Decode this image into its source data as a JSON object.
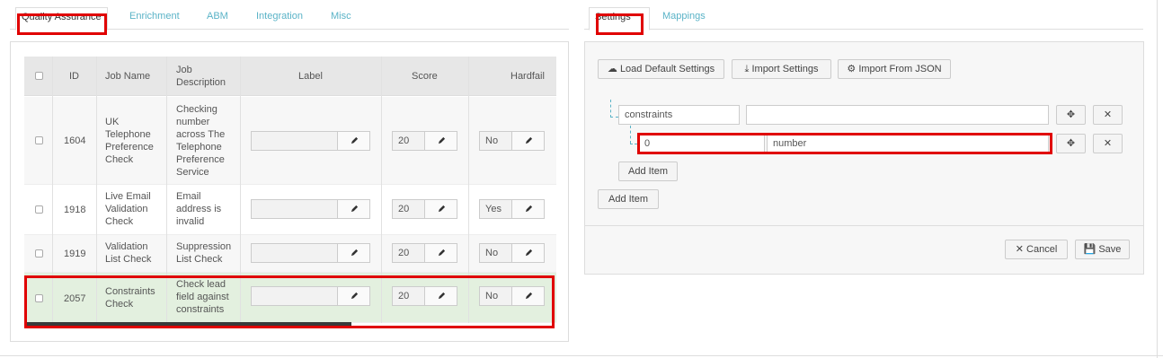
{
  "left_tabs": [
    "Quality Assurance",
    "Enrichment",
    "ABM",
    "Integration",
    "Misc"
  ],
  "right_tabs": [
    "Settings",
    "Mappings"
  ],
  "table": {
    "headers": [
      "ID",
      "Job Name",
      "Job Description",
      "Label",
      "Score",
      "Hardfail"
    ],
    "rows": [
      {
        "id": "1604",
        "name": "UK Telephone Preference Check",
        "desc": "Checking number across The Telephone Preference Service",
        "label": "",
        "score": "20",
        "hardfail": "No"
      },
      {
        "id": "1918",
        "name": "Live Email Validation Check",
        "desc": "Email address is invalid",
        "label": "",
        "score": "20",
        "hardfail": "Yes"
      },
      {
        "id": "1919",
        "name": "Validation List Check",
        "desc": "Suppression List Check",
        "label": "",
        "score": "20",
        "hardfail": "No"
      },
      {
        "id": "2057",
        "name": "Constraints Check",
        "desc": "Check lead field against constraints",
        "label": "",
        "score": "20",
        "hardfail": "No"
      }
    ]
  },
  "settings": {
    "load_default": "Load Default Settings",
    "import_settings": "Import Settings",
    "import_json": "Import From JSON",
    "key1": "constraints",
    "value1": "",
    "key2": "0",
    "value2": "number",
    "add_item_inner": "Add Item",
    "add_item_outer": "Add Item",
    "cancel": "Cancel",
    "save": "Save"
  },
  "colors": {
    "accent": "#5ab3c7",
    "highlight_red": "#e00000",
    "selected_row": "#e3f0df"
  }
}
